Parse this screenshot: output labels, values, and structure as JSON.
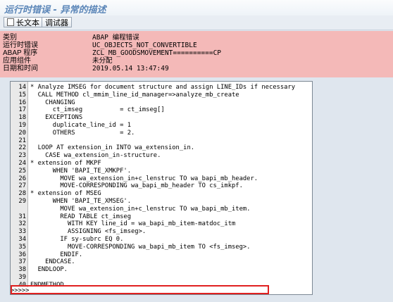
{
  "window": {
    "title": "运行时错误 - 异常的描述"
  },
  "toolbar": {
    "long_text_label": "长文本",
    "debugger_label": "调试器"
  },
  "info": [
    {
      "key": "类别",
      "value": "ABAP 编程错误"
    },
    {
      "key": "运行时错误",
      "value": "UC_OBJECTS_NOT_CONVERTIBLE"
    },
    {
      "key": "ABAP 程序",
      "value": "ZCL_MB_GOODSMOVEMENT==========CP"
    },
    {
      "key": "应用组件",
      "value": "未分配"
    },
    {
      "key": "日期和时间",
      "value": "2019.05.14 13:47:49"
    }
  ],
  "marker": ">>>>>",
  "code_lines": [
    {
      "n": "14",
      "t": "* Analyze IMSEG for document structure and assign LINE_IDs if necessary"
    },
    {
      "n": "15",
      "t": "  CALL METHOD cl_mmim_line_id_manager=>analyze_mb_create"
    },
    {
      "n": "16",
      "t": "    CHANGING"
    },
    {
      "n": "17",
      "t": "      ct_imseg          = ct_imseg[]"
    },
    {
      "n": "18",
      "t": "    EXCEPTIONS"
    },
    {
      "n": "19",
      "t": "      duplicate_line_id = 1"
    },
    {
      "n": "20",
      "t": "      OTHERS            = 2."
    },
    {
      "n": "21",
      "t": ""
    },
    {
      "n": "22",
      "t": "  LOOP AT extension_in INTO wa_extension_in."
    },
    {
      "n": "23",
      "t": "    CASE wa_extension_in-structure."
    },
    {
      "n": "24",
      "t": "* extension of MKPF"
    },
    {
      "n": "25",
      "t": "      WHEN 'BAPI_TE_XMKPF'."
    },
    {
      "n": "26",
      "t": "        MOVE wa_extension_in+c_lenstruc TO wa_bapi_mb_header."
    },
    {
      "n": "27",
      "t": "        MOVE-CORRESPONDING wa_bapi_mb_header TO cs_imkpf."
    },
    {
      "n": "28",
      "t": "* extension of MSEG"
    },
    {
      "n": "29",
      "t": "      WHEN 'BAPI_TE_XMSEG'."
    },
    {
      "n": "",
      "t": "        MOVE wa_extension_in+c_lenstruc TO wa_bapi_mb_item."
    },
    {
      "n": "31",
      "t": "        READ TABLE ct_imseg"
    },
    {
      "n": "32",
      "t": "          WITH KEY line_id = wa_bapi_mb_item-matdoc_itm"
    },
    {
      "n": "33",
      "t": "          ASSIGNING <fs_imseg>."
    },
    {
      "n": "34",
      "t": "        IF sy-subrc EQ 0."
    },
    {
      "n": "35",
      "t": "          MOVE-CORRESPONDING wa_bapi_mb_item TO <fs_imseg>."
    },
    {
      "n": "36",
      "t": "        ENDIF."
    },
    {
      "n": "37",
      "t": "    ENDCASE."
    },
    {
      "n": "38",
      "t": "  ENDLOOP."
    },
    {
      "n": "39",
      "t": ""
    },
    {
      "n": "40",
      "t": "ENDMETHOD."
    }
  ]
}
